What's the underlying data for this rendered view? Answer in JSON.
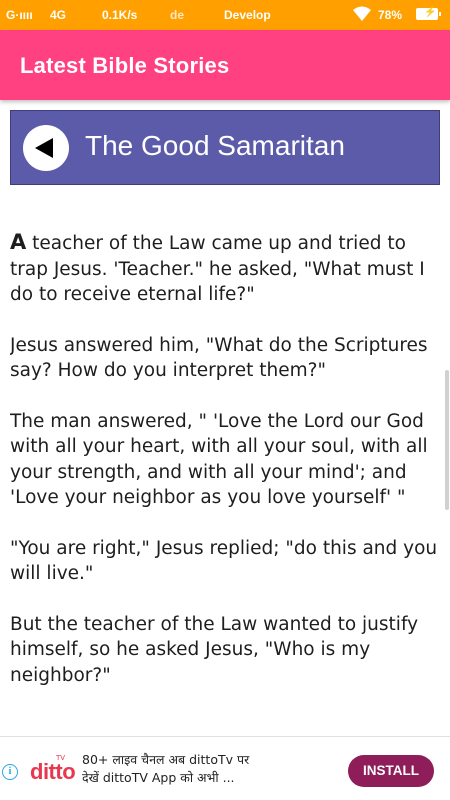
{
  "status_bar": {
    "signal": "G·ıııı",
    "network": "4G",
    "speed": "0.1K/s",
    "app_hint": "de",
    "carrier": "Develop",
    "battery_percent": "78%",
    "background_color": "#ffa000"
  },
  "app_bar": {
    "title": "Latest Bible Stories",
    "background_color": "#ff4081"
  },
  "story": {
    "title": "The Good Samaritan",
    "header_color": "#5c5ba9",
    "back_icon": "back-arrow-icon",
    "first_letter": "A",
    "paragraphs": [
      " teacher of the Law came up and tried to trap Jesus. 'Teacher.\" he asked, \"What must I do to receive eternal life?\"",
      "Jesus answered him, \"What do the Scriptures say? How do you interpret them?\"",
      "The man answered, \" 'Love the Lord our God with all your heart, with all your soul, with all your strength, and with all your mind'; and 'Love your neighbor as you love yourself' \"",
      "\"You are right,\" Jesus replied; \"do this and you will live.\"",
      "But the teacher of the Law wanted to justify himself, so he asked Jesus, \"Who is my neighbor?\""
    ]
  },
  "ad": {
    "logo": "ditto",
    "logo_sub": "TV",
    "line1": "80+ लाइव चैनल अब dittoTv पर",
    "line2": "देखें dittoTV App को अभी ...",
    "button_label": "INSTALL",
    "button_color": "#8e1d5a",
    "info_icon": "info-icon"
  }
}
